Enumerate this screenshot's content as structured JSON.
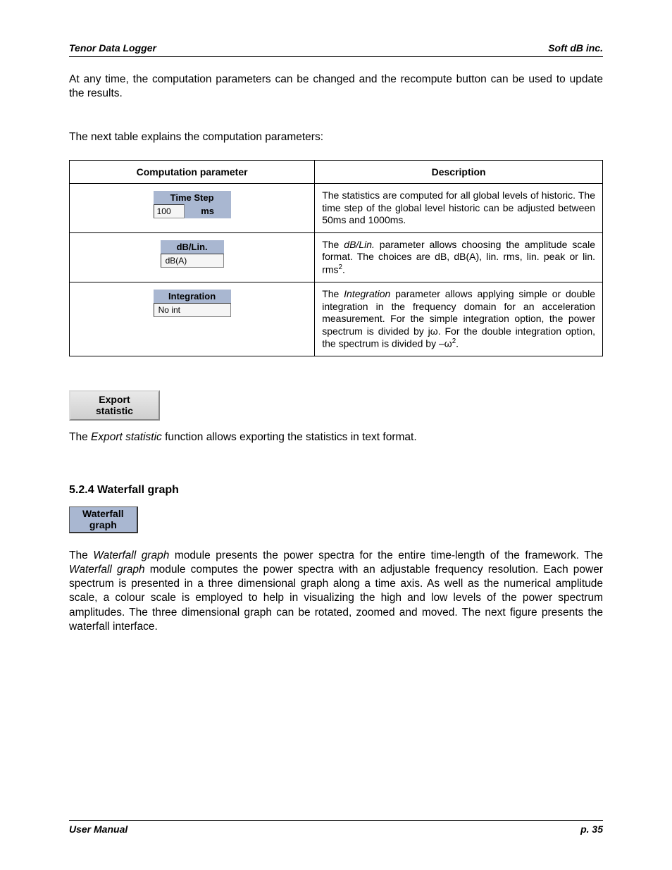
{
  "header": {
    "left": "Tenor Data Logger",
    "right": "Soft dB inc."
  },
  "footer": {
    "left": "User Manual",
    "right": "p. 35"
  },
  "intro1": "At any time, the computation parameters can be changed and the recompute button can be used to update the results.",
  "intro2": "The next table explains the computation parameters:",
  "table": {
    "head": {
      "c1": "Computation parameter",
      "c2": "Description"
    },
    "rows": [
      {
        "label": "Time Step",
        "value": "100",
        "unit": "ms",
        "desc_plain": "The statistics are computed for all global levels of historic. The time step of the global level historic can be adjusted between 50ms and 1000ms."
      },
      {
        "label": "dB/Lin.",
        "value": "dB(A)",
        "desc_html": "The <i>dB/Lin.</i> parameter allows choosing the amplitude scale format. The choices are dB, dB(A), lin. rms, lin. peak or lin. rms<sup>2</sup>."
      },
      {
        "label": "Integration",
        "value": "No int",
        "desc_html": "The <i>Integration</i> parameter allows applying simple or double integration in the frequency domain for an acceleration measurement. For the simple integration option, the power spectrum is divided by jω.  For the double integration option, the spectrum is divided by –ω<sup>2</sup>."
      }
    ]
  },
  "export_btn": {
    "l1": "Export",
    "l2": "statistic"
  },
  "export_para_html": "The <i>Export statistic</i> function allows exporting the statistics in text format.",
  "section": "5.2.4 Waterfall graph",
  "wf_btn": {
    "l1": "Waterfall",
    "l2": "graph"
  },
  "wf_para_html": "The <i>Waterfall graph</i> module presents the power spectra for the entire time-length of the framework. The <i>Waterfall graph</i> module computes the power spectra with an adjustable frequency resolution. Each power spectrum is presented in a three dimensional graph along a time axis. As well as the numerical amplitude scale, a colour scale is employed to help in visualizing the high and low levels of the power spectrum amplitudes. The three dimensional graph can be rotated, zoomed and moved. The next figure presents the waterfall interface."
}
